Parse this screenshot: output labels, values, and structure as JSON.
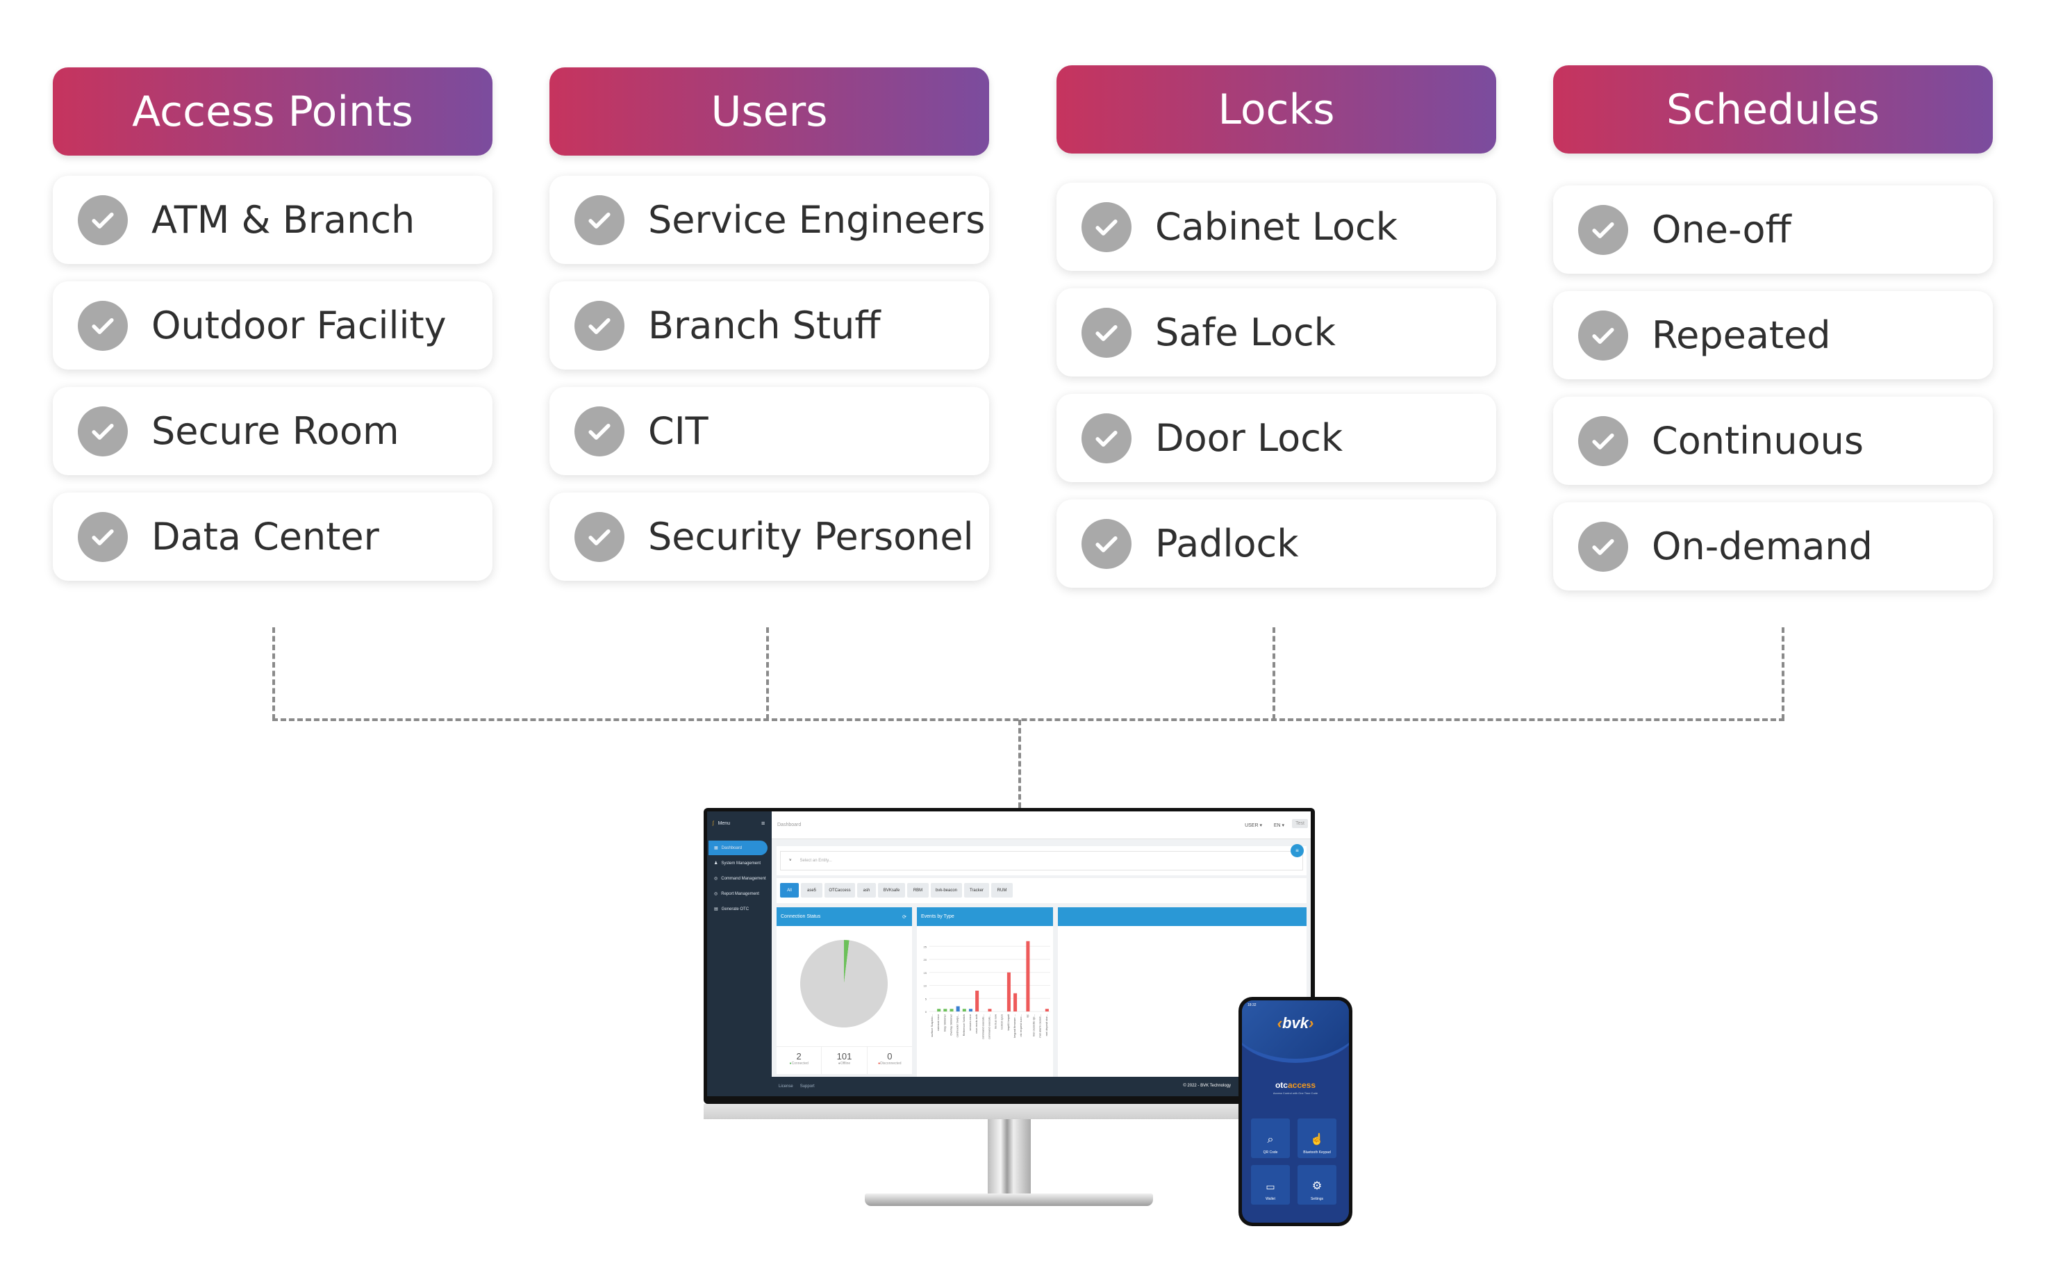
{
  "columns": [
    {
      "title": "Access Points",
      "items": [
        "ATM & Branch",
        "Outdoor Facility",
        "Secure Room",
        "Data Center"
      ]
    },
    {
      "title": "Users",
      "items": [
        "Service Engineers",
        "Branch Stuff",
        "CIT",
        "Security Personel"
      ]
    },
    {
      "title": "Locks",
      "items": [
        "Cabinet Lock",
        "Safe Lock",
        "Door Lock",
        "Padlock"
      ]
    },
    {
      "title": "Schedules",
      "items": [
        "One-off",
        "Repeated",
        "Continuous",
        "On-demand"
      ]
    }
  ],
  "colors": {
    "gradient_start": "#c6345e",
    "gradient_end": "#7b4c9e",
    "check": "#a9a9a9",
    "sidebar": "#22303f",
    "accent": "#2a98d6"
  },
  "dashboard": {
    "menu_label": "Menu",
    "sidebar": [
      "Dashboard",
      "System Management",
      "Command Management",
      "Report Management",
      "Generate OTC"
    ],
    "page_title": "Dashboard",
    "user_menu": "USER ▾",
    "lang_menu": "EN ▾",
    "test_button": "Test",
    "entity_placeholder": "Select an Entity...",
    "filters": [
      "All",
      "ase5",
      "OTCaccess",
      "ash",
      "BVKsafe",
      "RBM",
      "bvk-beacon",
      "Tracker",
      "RUM"
    ],
    "connection_title": "Connection Status",
    "events_title": "Events by Type",
    "stats": [
      {
        "value": "2",
        "label": "Connected",
        "color": "#5cb85c"
      },
      {
        "value": "101",
        "label": "Offline",
        "color": "#999999"
      },
      {
        "value": "0",
        "label": "Disconnected",
        "color": "#e74c3c"
      }
    ],
    "footer_links": [
      "License",
      "Support"
    ],
    "copyright": "© 2022 - BVK Technology"
  },
  "chart_data": [
    {
      "type": "pie",
      "title": "Connection Status",
      "categories": [
        "Connected",
        "Offline",
        "Disconnected"
      ],
      "values": [
        2,
        101,
        0
      ],
      "colors": [
        "#6cc05a",
        "#d6d6d6",
        "#e74c3c"
      ]
    },
    {
      "type": "bar",
      "title": "Events by Type",
      "ylim": [
        0,
        25
      ],
      "yticks": [
        0,
        5,
        10,
        15,
        20,
        25
      ],
      "grid": true,
      "categories": [
        "surface Suspicio...",
        "external error",
        "Inlay Skimmer",
        "Overlay Skimmer",
        "cardreader Swipi...",
        "Reference Switch",
        "sensors error",
        "ceza modu acik",
        "command execute...",
        "command execute...",
        "lnx bus now",
        "lock03 open",
        "kapi01 kapali",
        "keypad firmware ...",
        "otc request succ...",
        "ojc",
        "mei cassette eje...",
        "mei alarm casset...",
        "mei deposit star..."
      ],
      "values": [
        0,
        1,
        1,
        1,
        2,
        1,
        1,
        8,
        0,
        1,
        0,
        0,
        15,
        7,
        0,
        27,
        0,
        0,
        1
      ],
      "colors": [
        "#6cc05a",
        "#6cc05a",
        "#6cc05a",
        "#6cc05a",
        "#3a7fd0",
        "#6cc05a",
        "#3a7fd0",
        "#ee5a5a",
        "#ee5a5a",
        "#ee5a5a",
        "#ee5a5a",
        "#ee5a5a",
        "#ee5a5a",
        "#ee5a5a",
        "#ee5a5a",
        "#ee5a5a",
        "#ee5a5a",
        "#ee5a5a",
        "#ee5a5a"
      ]
    }
  ],
  "phone": {
    "time": "18:32",
    "brand": "bvk",
    "app_name_a": "otc",
    "app_name_b": "access",
    "tagline": "Access Control with One Time Code",
    "tiles": [
      "QR Code",
      "Bluetooth Keypad",
      "Wallet",
      "Settings"
    ]
  }
}
